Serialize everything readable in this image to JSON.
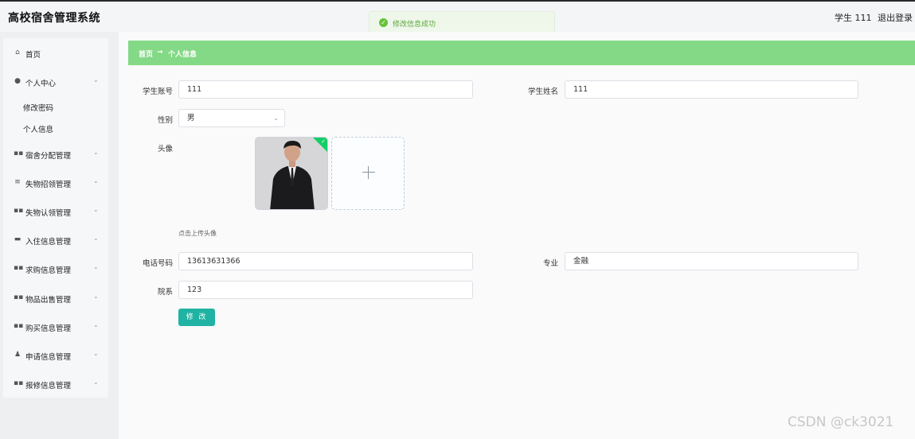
{
  "header": {
    "app_title": "高校宿舍管理系统",
    "user_name": "学生 111",
    "logout_label": "退出登录"
  },
  "toast": {
    "message": "修改信息成功",
    "icon": "success-check-icon",
    "color": "#67c23a"
  },
  "sidebar": {
    "items": [
      {
        "label": "首页",
        "icon": "home-icon",
        "expandable": false
      },
      {
        "label": "个人中心",
        "icon": "user-icon",
        "expandable": true,
        "children": [
          "修改密码",
          "个人信息"
        ]
      },
      {
        "label": "宿舍分配管理",
        "icon": "grid-icon",
        "expandable": true
      },
      {
        "label": "失物招领管理",
        "icon": "list-icon",
        "expandable": true
      },
      {
        "label": "失物认领管理",
        "icon": "grid-icon",
        "expandable": true
      },
      {
        "label": "入住信息管理",
        "icon": "bed-icon",
        "expandable": true
      },
      {
        "label": "求购信息管理",
        "icon": "grid-icon",
        "expandable": true
      },
      {
        "label": "物品出售管理",
        "icon": "grid-icon",
        "expandable": true
      },
      {
        "label": "购买信息管理",
        "icon": "grid-icon",
        "expandable": true
      },
      {
        "label": "申请信息管理",
        "icon": "person-icon",
        "expandable": true
      },
      {
        "label": "报修信息管理",
        "icon": "grid-icon",
        "expandable": true
      }
    ]
  },
  "breadcrumb": {
    "home": "首页",
    "separator": "→",
    "current": "个人信息",
    "bar_color": "#84d986"
  },
  "form": {
    "student_account": {
      "label": "学生账号",
      "value": "111"
    },
    "student_name": {
      "label": "学生姓名",
      "value": "111"
    },
    "gender": {
      "label": "性别",
      "value": "男"
    },
    "avatar": {
      "label": "头像",
      "tip": "点击上传头像"
    },
    "phone": {
      "label": "电话号码",
      "value": "13613631366"
    },
    "major": {
      "label": "专业",
      "value": "金融"
    },
    "department": {
      "label": "院系",
      "value": "123"
    },
    "submit_label": "修 改",
    "submit_color": "#20b2a2"
  },
  "watermark": "CSDN @ck3021"
}
